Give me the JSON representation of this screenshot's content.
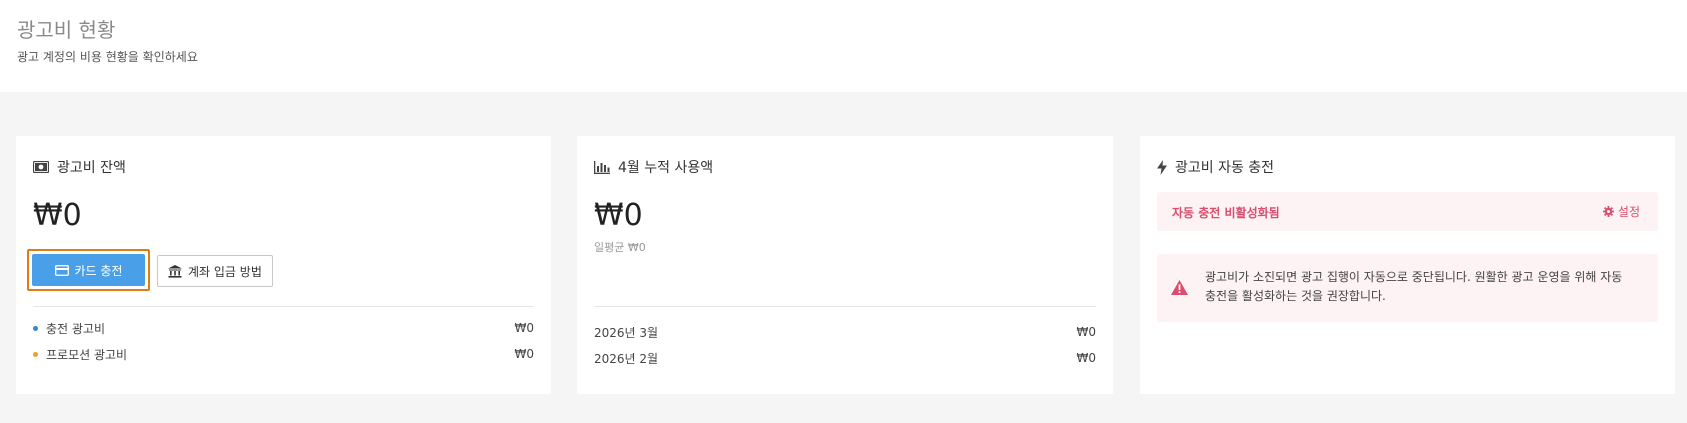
{
  "header": {
    "title": "광고비 현황",
    "subtitle": "광고 계정의 비용 현황을 확인하세요"
  },
  "balance_card": {
    "title": "광고비 잔액",
    "amount": "₩0",
    "card_charge_button": "카드 충전",
    "bank_deposit_button": "계좌 입금 방법",
    "items": [
      {
        "label": "충전 광고비",
        "value": "₩0",
        "dot_color": "#3b82d6"
      },
      {
        "label": "프로모션 광고비",
        "value": "₩0",
        "dot_color": "#f0a028"
      }
    ]
  },
  "usage_card": {
    "title": "4월 누적 사용액",
    "amount": "₩0",
    "daily_average": "일평균 ₩0",
    "months": [
      {
        "label": "2026년 3월",
        "value": "₩0"
      },
      {
        "label": "2026년 2월",
        "value": "₩0"
      }
    ]
  },
  "auto_charge_card": {
    "title": "광고비 자동 충전",
    "status": "자동 충전 비활성화됨",
    "settings_button": "설정",
    "warning": "광고비가 소진되면 광고 집행이 자동으로 중단됩니다. 원활한 광고 운영을 위해 자동 충전을 활성화하는 것을 권장합니다."
  },
  "colors": {
    "accent": "#4aa0e8",
    "highlight_border": "#e37b14",
    "alert_text": "#d94d6e",
    "alert_bg": "#fdf2f4"
  }
}
